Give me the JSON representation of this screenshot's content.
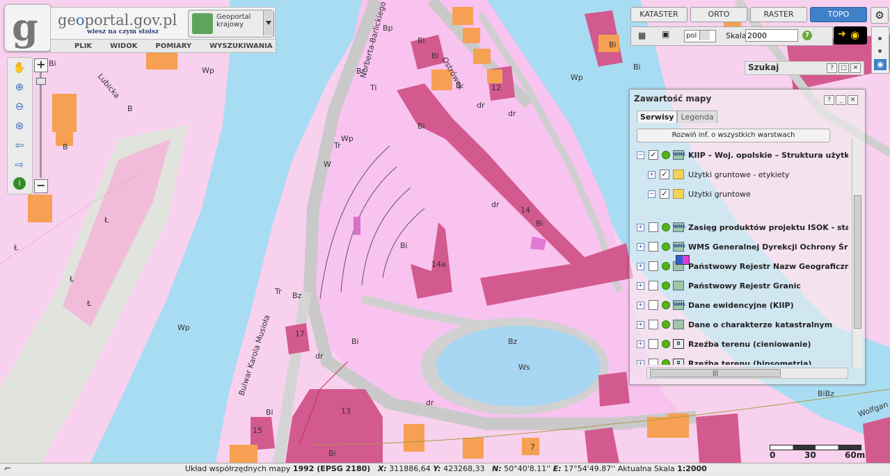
{
  "logo": {
    "site_name_prefix": "ge",
    "site_name_accent": "o",
    "site_name_rest": "portal.gov.pl",
    "tagline": "wiesz na czym stoisz",
    "letter": "g"
  },
  "geoportal_select": {
    "label": "Geoportal krajowy"
  },
  "menu": [
    "PLIK",
    "WIDOK",
    "POMIARY",
    "WYSZUKIWANIA"
  ],
  "view_buttons": [
    {
      "label": "KATASTER",
      "active": false
    },
    {
      "label": "ORTO",
      "active": false
    },
    {
      "label": "RASTER",
      "active": false
    },
    {
      "label": "TOPO",
      "active": true
    }
  ],
  "scale_bar": {
    "language": "pol",
    "label": "Skala:",
    "value": "2000"
  },
  "search": {
    "label": "Szukaj"
  },
  "panel": {
    "title": "Zawartość mapy",
    "tabs": [
      {
        "label": "Serwisy",
        "active": true
      },
      {
        "label": "Legenda",
        "active": false
      }
    ],
    "expand_button": "Rozwiń inf. o wszystkich warstwach",
    "layers": [
      {
        "name": "KIIP – Woj. opolskie – Struktura użytkow",
        "bold": true,
        "expander": "−",
        "checked": true,
        "dot": true,
        "icon": "wms-icon",
        "indent": 0
      },
      {
        "name": "Użytki gruntowe - etykiety",
        "bold": false,
        "expander": "+",
        "checked": true,
        "dot": false,
        "icon": "folder-icon",
        "indent": 1
      },
      {
        "name": "Użytki gruntowe",
        "bold": false,
        "expander": "−",
        "checked": true,
        "dot": false,
        "icon": "folder-icon",
        "indent": 1
      },
      {
        "name": "Zasięg produktów projektu ISOK - stan n",
        "bold": true,
        "expander": "+",
        "checked": false,
        "dot": true,
        "icon": "wms-icon",
        "indent": 0
      },
      {
        "name": "WMS Generalnej Dyrekcji Ochrony Środo",
        "bold": true,
        "expander": "+",
        "checked": false,
        "dot": true,
        "icon": "wms-icon",
        "indent": 0
      },
      {
        "name": "Państwowy Rejestr Nazw Geograficznych",
        "bold": true,
        "expander": "+",
        "checked": false,
        "dot": true,
        "icon": "map-icon",
        "indent": 0
      },
      {
        "name": "Państwowy Rejestr Granic",
        "bold": true,
        "expander": "+",
        "checked": false,
        "dot": true,
        "icon": "map-icon",
        "indent": 0
      },
      {
        "name": "Dane ewidencyjne (KIIP)",
        "bold": true,
        "expander": "+",
        "checked": false,
        "dot": true,
        "icon": "wms-icon",
        "indent": 0
      },
      {
        "name": "Dane o charakterze katastralnym",
        "bold": true,
        "expander": "+",
        "checked": false,
        "dot": true,
        "icon": "map-icon",
        "indent": 0
      },
      {
        "name": "Rzeźba terenu (cieniowanie)",
        "bold": true,
        "expander": "+",
        "checked": false,
        "dot": true,
        "icon": "relief-icon",
        "indent": 0
      },
      {
        "name": "Rzeźba terenu (hipsometria)",
        "bold": true,
        "expander": "+",
        "checked": false,
        "dot": true,
        "icon": "relief-icon",
        "indent": 0
      }
    ]
  },
  "map_scale": {
    "labels": [
      "0",
      "30",
      "60m"
    ]
  },
  "status": {
    "label1": "Układ współrzędnych mapy",
    "crs": "1992 (EPSG 2180)",
    "x_label": "X:",
    "x_value": "311886,64",
    "y_label": "Y:",
    "y_value": "423268,33",
    "n_label": "N:",
    "n_value": "50°40'8.11''",
    "e_label": "E:",
    "e_value": "17°54'49.87''",
    "scale_label": "Aktualna Skala",
    "scale_value": "1:2000"
  },
  "map_labels": [
    "Bp",
    "Bi",
    "B",
    "Wp",
    "Br",
    "Ti",
    "Tr",
    "W",
    "Bz",
    "Ws",
    "dr",
    "Ł",
    "Bi",
    "14",
    "14a",
    "13",
    "15",
    "17",
    "12",
    "7",
    "Bp",
    "Bp",
    "Bi",
    "Bi",
    "Bi"
  ],
  "street_labels": [
    "Norberta-Barlickiego",
    "Ostrówek",
    "Bulwar Karola Musioła",
    "Lubicka",
    "Wolfgan"
  ],
  "colors": {
    "water": "#a8dcf3",
    "built": "#f7c6ee",
    "industrial": "#d35a8e",
    "residential": "#f5a052",
    "road": "#cfcfcf",
    "accent": "#3f80c8"
  }
}
